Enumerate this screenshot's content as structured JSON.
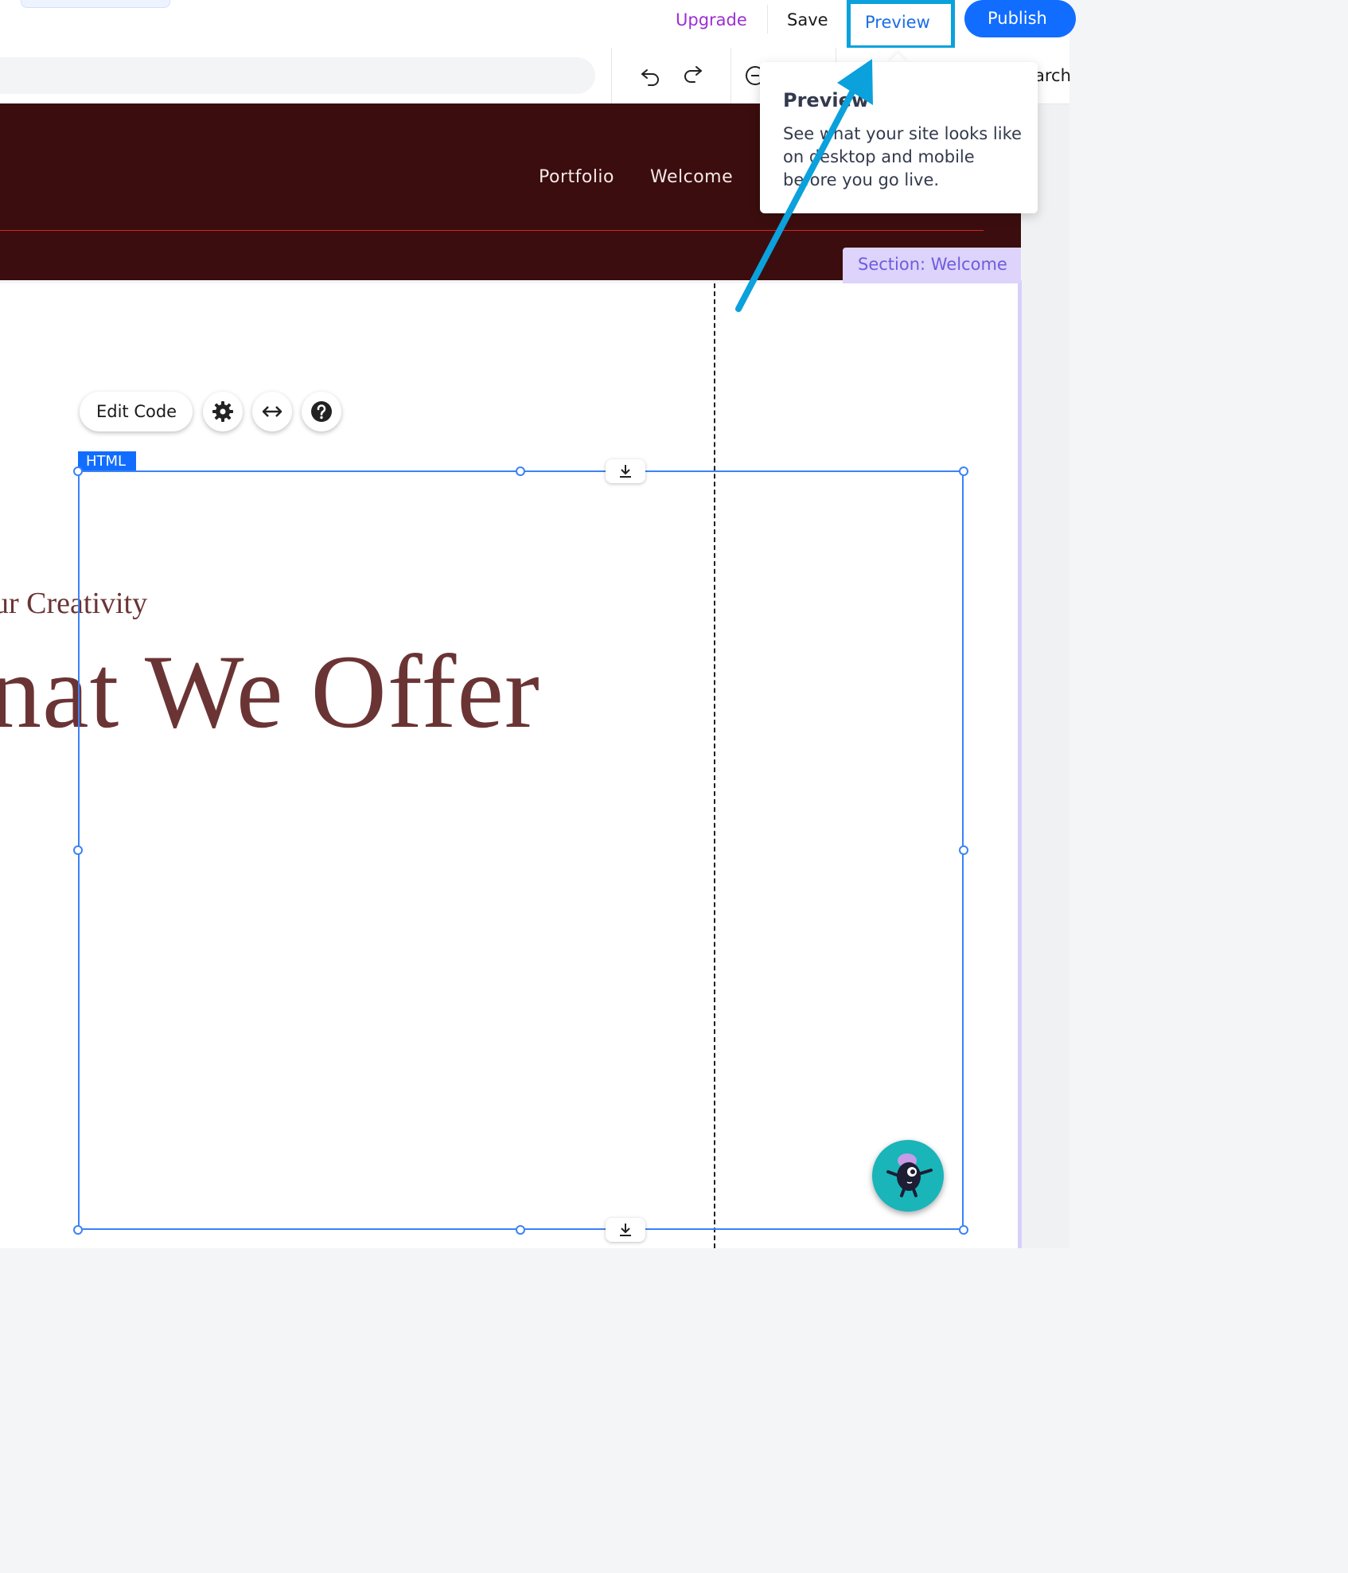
{
  "topbar": {
    "upgrade_label": "Upgrade",
    "save_label": "Save",
    "preview_label": "Preview",
    "publish_label": "Publish"
  },
  "toolbar": {
    "search_fragment": "arch"
  },
  "site": {
    "nav": [
      "Portfolio",
      "Welcome"
    ],
    "section_label": "Section: Welcome",
    "subtitle": "ur Creativity",
    "title": "nat We Offer"
  },
  "element_toolbar": {
    "edit_code_label": "Edit Code",
    "element_type_label": "HTML"
  },
  "tooltip": {
    "title": "Preview",
    "description": "See what your site looks like on desktop and mobile before you go live."
  },
  "colors": {
    "accent": "#116dff",
    "highlight": "#0aa1dd",
    "header_bg": "#3b0d0e",
    "heading_text": "#6b3434",
    "section_tag": "#ddd3fb"
  }
}
